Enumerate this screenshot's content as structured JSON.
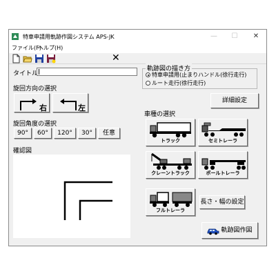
{
  "window": {
    "title": "特車申請用軌跡作図システム APS-JK",
    "controls": {
      "minimize": "—",
      "maximize": "☐",
      "close": "✕"
    }
  },
  "menu": {
    "items": [
      "ファイル(F)",
      "ヘルプ(H)"
    ]
  },
  "toolbar": {
    "icons": [
      "new-file-icon",
      "open-folder-icon",
      "save-icon",
      "save-as-icon"
    ],
    "close_label": "✕"
  },
  "form": {
    "title_label": "タイトル",
    "title_value": "",
    "turn_direction_label": "旋回方向の選択",
    "turn_right_label": "右",
    "turn_left_label": "左",
    "turn_angle_label": "旋回角度の選択",
    "angles": [
      "90°",
      "60°",
      "120°",
      "30°",
      "任意"
    ],
    "preview_label": "確認図"
  },
  "trajectory": {
    "group_title": "軌跡図の描き方",
    "options": [
      {
        "label": "特車申請用(止まりハンドル(徐行走行)",
        "selected": true
      },
      {
        "label": "ルート走行(徐行走行)",
        "selected": false
      }
    ]
  },
  "detail_button_label": "詳細設定",
  "vehicles": {
    "section_label": "車種の選択",
    "items": [
      "トラック",
      "セミトレーラ",
      "クレーントラック",
      "ポールトレーラ",
      "フルトレーラ"
    ]
  },
  "size_button_label": "長さ・幅の設定",
  "draw_button_label": "軌跡図作図",
  "colors": {
    "window_bg": "#f0f0f0",
    "icon_blue": "#1f4fbf",
    "icon_red": "#c0392b",
    "app_icon_green": "#2e8b57"
  }
}
